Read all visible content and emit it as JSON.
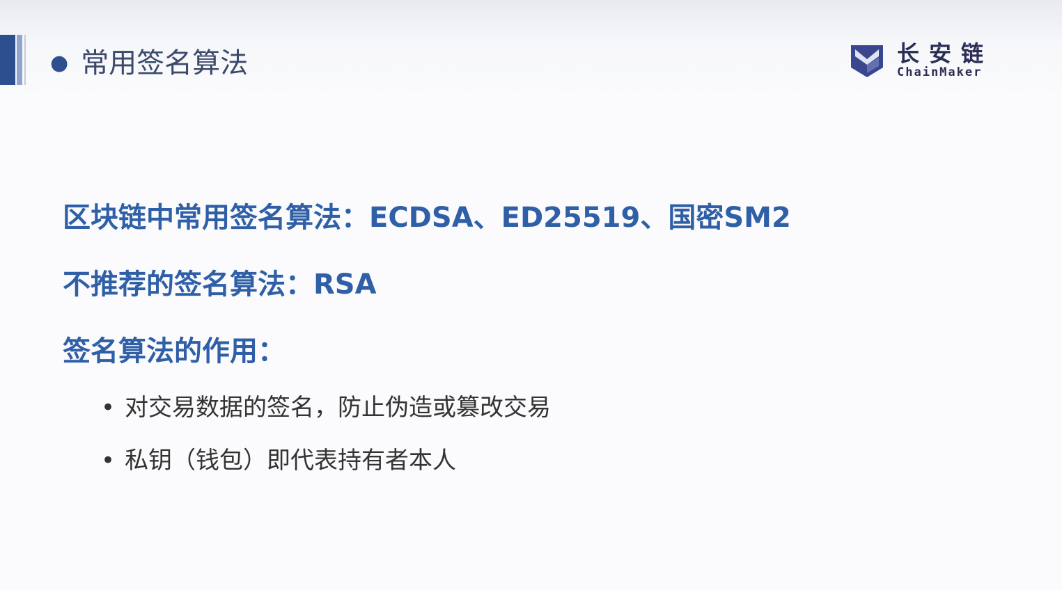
{
  "header": {
    "title": "常用签名算法",
    "logo_cn": "长安链",
    "logo_en": "ChainMaker"
  },
  "content": {
    "line1": "区块链中常用签名算法：ECDSA、ED25519、国密SM2",
    "line2": "不推荐的签名算法：RSA",
    "line3": "签名算法的作用：",
    "bullets": [
      "对交易数据的签名，防止伪造或篡改交易",
      "私钥（钱包）即代表持有者本人"
    ]
  },
  "colors": {
    "accent": "#2d4f8e",
    "text_blue": "#2f5fa6"
  }
}
